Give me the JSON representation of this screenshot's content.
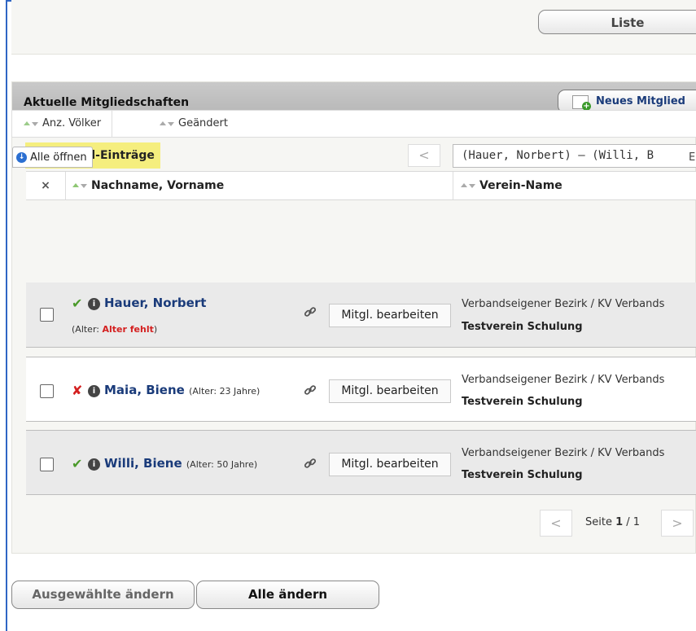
{
  "toolbar": {
    "liste_label": "Liste"
  },
  "panel": {
    "title": "Aktuelle Mitgliedschaften",
    "new_member_label": "Neues Mitglied",
    "count_label": "3 Mitglied-Einträge",
    "prev_symbol": "<",
    "range_text": "(Hauer, Norbert) – (Willi, B"
  },
  "sort": {
    "items": [
      {
        "label": "Anz. Völker"
      },
      {
        "label": "Geändert"
      }
    ]
  },
  "list": {
    "expand_all_label": "Alle öffnen",
    "info_glyph": "i",
    "right_label": "E",
    "columns": {
      "select": "×",
      "name": "Nachname, Vorname",
      "verein": "Verein-Name"
    },
    "rows": [
      {
        "status": "✔",
        "name": "Hauer, Norbert",
        "age_prefix": "(Alter: ",
        "age_value": "Alter fehlt",
        "age_suffix": ")",
        "edit_label": "Mitgl. bearbeiten",
        "verein_line1": "Verbandseigener Bezirk / KV Verbands",
        "verein_line2": "Testverein Schulung"
      },
      {
        "status": "✘",
        "name": "Maia, Biene",
        "age": "(Alter: 23 Jahre)",
        "edit_label": "Mitgl. bearbeiten",
        "verein_line1": "Verbandseigener Bezirk / KV Verbands",
        "verein_line2": "Testverein Schulung"
      },
      {
        "status": "✔",
        "name": "Willi, Biene",
        "age": "(Alter: 50 Jahre)",
        "edit_label": "Mitgl. bearbeiten",
        "verein_line1": "Verbandseigener Bezirk / KV Verbands",
        "verein_line2": "Testverein Schulung"
      }
    ]
  },
  "pagination": {
    "prev": "<",
    "next": ">",
    "page_prefix": "Seite ",
    "page_current": "1",
    "page_sep": " / ",
    "page_total": "1"
  },
  "actions": {
    "selected_label": "Ausgewählte ändern",
    "all_label": "Alle ändern"
  },
  "icons": {
    "link": "link-icon",
    "sort": "sort-arrows-icon",
    "new_member": "add-member-icon"
  },
  "colors": {
    "accent_blue": "#2f66c4",
    "ok_green": "#4a9a2a",
    "error_red": "#d42020",
    "highlight": "#f5ee7e"
  }
}
